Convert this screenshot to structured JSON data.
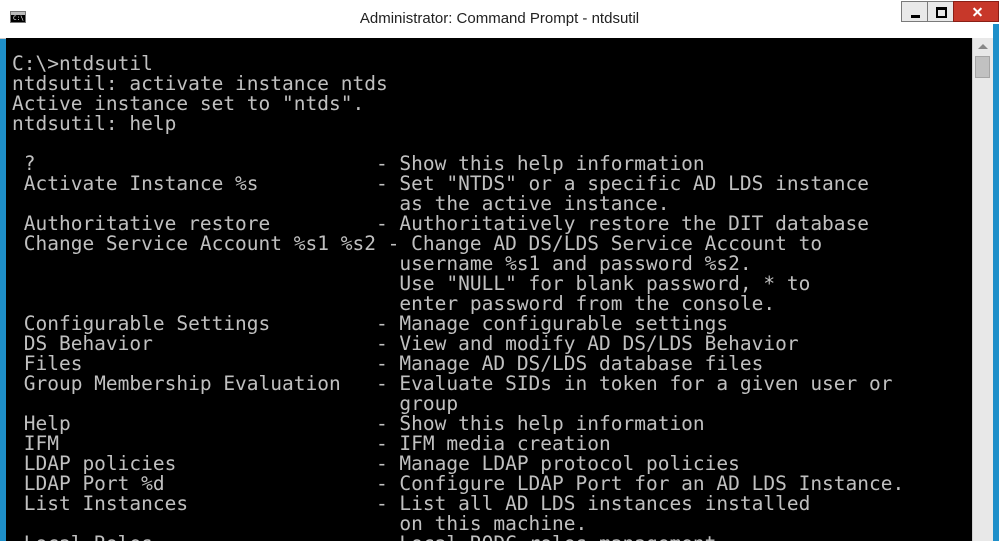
{
  "window": {
    "title": "Administrator: Command Prompt - ntdsutil",
    "icon_text": "C:\\"
  },
  "controls": {
    "minimize": "minimize-icon",
    "maximize": "maximize-icon",
    "close": "close-icon"
  },
  "console": {
    "lines": [
      "C:\\>ntdsutil",
      "ntdsutil: activate instance ntds",
      "Active instance set to \"ntds\".",
      "ntdsutil: help",
      "",
      " ?                             - Show this help information",
      " Activate Instance %s          - Set \"NTDS\" or a specific AD LDS instance",
      "                                 as the active instance.",
      " Authoritative restore         - Authoritatively restore the DIT database",
      " Change Service Account %s1 %s2 - Change AD DS/LDS Service Account to",
      "                                 username %s1 and password %s2.",
      "                                 Use \"NULL\" for blank password, * to",
      "                                 enter password from the console.",
      " Configurable Settings         - Manage configurable settings",
      " DS Behavior                   - View and modify AD DS/LDS Behavior",
      " Files                         - Manage AD DS/LDS database files",
      " Group Membership Evaluation   - Evaluate SIDs in token for a given user or",
      "                                 group",
      " Help                          - Show this help information",
      " IFM                           - IFM media creation",
      " LDAP policies                 - Manage LDAP protocol policies",
      " LDAP Port %d                  - Configure LDAP Port for an AD LDS Instance.",
      " List Instances                - List all AD LDS instances installed",
      "                                 on this machine.",
      " Local Roles                   - Local RODC roles management"
    ]
  },
  "colors": {
    "frame": "#1e8fc9",
    "console_bg": "#000000",
    "console_text": "#c0c0c0",
    "close_button": "#c7382a"
  }
}
